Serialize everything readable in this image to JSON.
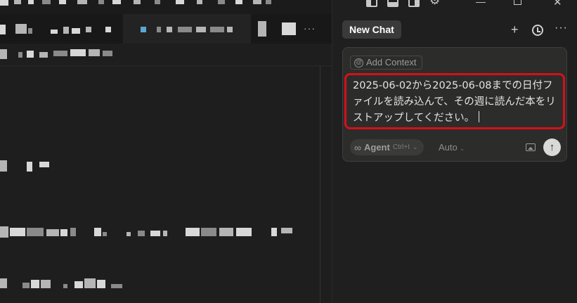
{
  "chat_panel": {
    "header": {
      "new_chat_label": "New Chat",
      "plus_icon": "plus-icon",
      "history_icon": "history-icon",
      "more_icon": "more-icon",
      "more_label": "···"
    },
    "composer": {
      "add_context_label": "Add Context",
      "input_value": "2025-06-02から2025-06-08までの日付ファイルを読み込んで、その週に読んだ本をリストアップしてください。",
      "input_highlight_color": "#d4111a",
      "mode_label": "Agent",
      "mode_shortcut": "Ctrl+I",
      "model_label": "Auto"
    }
  },
  "window_controls": {
    "icons": [
      "layout-sidebar-left-icon",
      "layout-panel-icon",
      "layout-sidebar-right-icon",
      "gear-icon",
      "minimize-icon",
      "restore-icon",
      "close-icon"
    ]
  },
  "editor": {
    "tab_more_label": "···"
  },
  "colors": {
    "background": "#1f1f1f",
    "composer_bg": "#2c2c2a",
    "new_chat_bg": "#3a3a3a"
  }
}
